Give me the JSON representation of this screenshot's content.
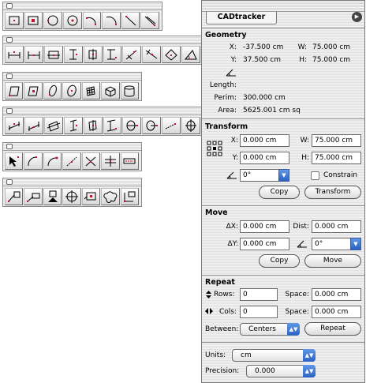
{
  "palettes": [
    {
      "name": "drawing",
      "tools": [
        "rectangle-tool",
        "center-rectangle-tool",
        "circle-tool",
        "center-circle-tool",
        "arc-tool",
        "arc-end-tool",
        "line-tool",
        "hatched-line-tool"
      ]
    },
    {
      "name": "dimension",
      "tools": [
        "h-dim-tool",
        "h-dim-mid-tool",
        "h-dim-box-tool",
        "v-dim-tool",
        "v-dim-box-tool",
        "v-dim-end-tool",
        "angled-dim-tool",
        "angled-dim-2-tool",
        "angled-dim-3-tool",
        "angle-dim-tool"
      ]
    },
    {
      "name": "3d-shapes",
      "tools": [
        "parallelogram-tool",
        "parallelogram-center-tool",
        "ellipse-3d-tool",
        "ellipse-center-3d-tool",
        "grid-3d-tool",
        "cube-tool",
        "cylinder-tool"
      ]
    },
    {
      "name": "3d-dimension",
      "tools": [
        "iso-h-dim-tool",
        "iso-h-dim-mid-tool",
        "iso-box-dim-tool",
        "iso-v-dim-tool",
        "iso-v-mid-tool",
        "iso-v-end-tool",
        "diameter-dim-tool",
        "radius-dim-tool",
        "leader-dim-tool",
        "center-mark-tool"
      ]
    },
    {
      "name": "selection",
      "tools": [
        "direct-select-tool",
        "arc-select-tool",
        "arc-point-tool",
        "line-point-tool",
        "crossing-tool",
        "break-tool",
        "dash-tool"
      ]
    },
    {
      "name": "annotation",
      "tools": [
        "leader-label-tool",
        "label-line-tool",
        "datum-tool",
        "target-tool",
        "balloon-label-tool",
        "cloud-tool",
        "callout-tool"
      ]
    }
  ],
  "cadtracker": {
    "title": "CADtracker",
    "geometry": {
      "title": "Geometry",
      "x_label": "X:",
      "x_value": "-37.500 cm",
      "w_label": "W:",
      "w_value": "75.000 cm",
      "y_label": "Y:",
      "y_value": "37.500 cm",
      "h_label": "H:",
      "h_value": "75.000 cm",
      "length_label": "Length:",
      "perim_label": "Perim:",
      "perim_value": "300.000 cm",
      "area_label": "Area:",
      "area_value": "5625.001 cm sq"
    },
    "transform": {
      "title": "Transform",
      "x_label": "X:",
      "x_value": "0.000 cm",
      "w_label": "W:",
      "w_value": "75.000 cm",
      "y_label": "Y:",
      "y_value": "0.000 cm",
      "h_label": "H:",
      "h_value": "75.000 cm",
      "angle_value": "0°",
      "constrain_label": "Constrain",
      "copy_label": "Copy",
      "transform_label": "Transform"
    },
    "move": {
      "title": "Move",
      "dx_label": "ΔX:",
      "dx_value": "0.000 cm",
      "dist_label": "Dist:",
      "dist_value": "0.000 cm",
      "dy_label": "ΔY:",
      "dy_value": "0.000 cm",
      "angle_value": "0°",
      "copy_label": "Copy",
      "move_label": "Move"
    },
    "repeat": {
      "title": "Repeat",
      "rows_label": "Rows:",
      "rows_value": "0",
      "row_space_label": "Space:",
      "row_space_value": "0.000 cm",
      "cols_label": "Cols:",
      "cols_value": "0",
      "col_space_label": "Space:",
      "col_space_value": "0.000 cm",
      "between_label": "Between:",
      "between_value": "Centers",
      "repeat_label": "Repeat"
    },
    "settings": {
      "units_label": "Units:",
      "units_value": "cm",
      "precision_label": "Precision:",
      "precision_value": "0.000"
    }
  }
}
